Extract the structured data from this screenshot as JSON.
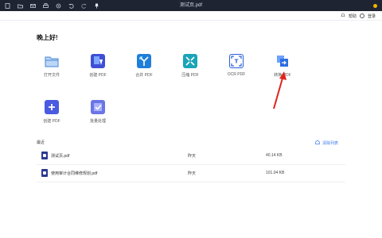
{
  "titlebar": {
    "title": "测试页.pdf",
    "icons": [
      "file-icon",
      "open-folder-icon",
      "mail-icon",
      "print-icon",
      "settings-icon",
      "undo-icon",
      "redo-icon",
      "pin-icon"
    ]
  },
  "subbar": {
    "help_label": "帮助",
    "user_label": "登录"
  },
  "greeting": "晚上好!",
  "tools": [
    {
      "label": "打开文件",
      "icon": "folder-icon",
      "color": "#e8f2ff"
    },
    {
      "label": "创建 PDF",
      "icon": "create-pdf-icon",
      "color": "#3e4fd6"
    },
    {
      "label": "合并 PDF",
      "icon": "merge-pdf-icon",
      "color": "#1f7fd8"
    },
    {
      "label": "压缩 PDF",
      "icon": "compress-pdf-icon",
      "color": "#1aa4b8"
    },
    {
      "label": "OCR PDF",
      "icon": "ocr-pdf-icon",
      "color": "#2b5fd9"
    },
    {
      "label": "转换 PDF",
      "icon": "convert-pdf-icon",
      "color": "#2d6fe0"
    },
    {
      "label": "创建 PDF",
      "icon": "add-pdf-icon",
      "color": "#4a5be0"
    },
    {
      "label": "批量处理",
      "icon": "batch-process-icon",
      "color": "#6b76e6"
    }
  ],
  "recent": {
    "title": "最近",
    "clear_label": "清除列表",
    "files": [
      {
        "name": "测试页.pdf",
        "date": "昨天",
        "size": "40.14 KB"
      },
      {
        "name": "使用审计合同维修规划.pdf",
        "date": "昨天",
        "size": "101.04 KB"
      }
    ]
  },
  "colors": {
    "titlebar_bg": "#1f2433",
    "accent": "#3a7bf0",
    "annotation": "#e0241b"
  }
}
